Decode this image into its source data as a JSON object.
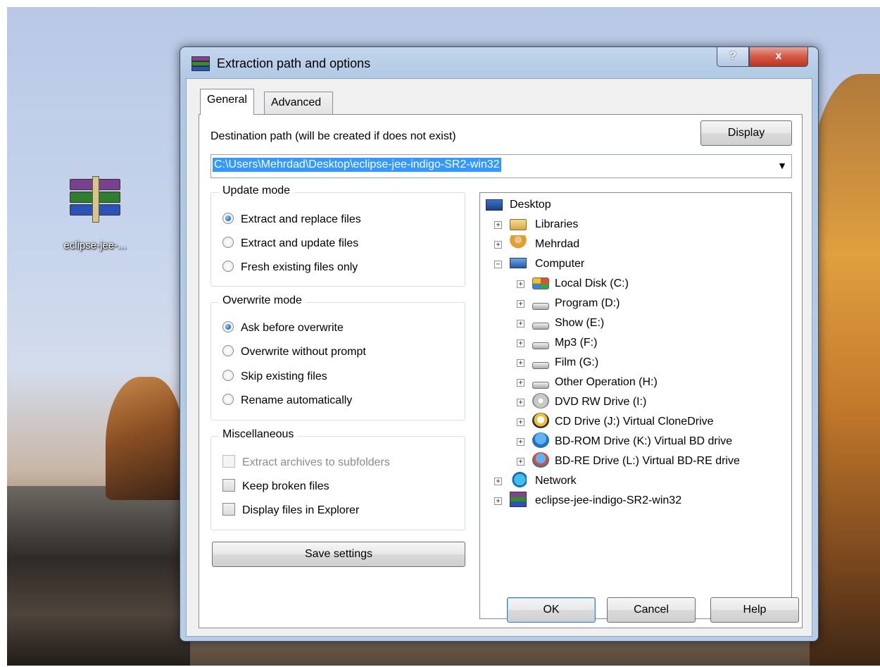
{
  "desktop": {
    "icon_label": "eclipse-jee-..."
  },
  "window": {
    "title": "Extraction path and options",
    "help_caption": "?",
    "close_caption": "x"
  },
  "tabs": [
    {
      "label": "General",
      "active": true
    },
    {
      "label": "Advanced",
      "active": false
    }
  ],
  "destination": {
    "label": "Destination path (will be created if does not exist)",
    "value": "C:\\Users\\Mehrdad\\Desktop\\eclipse-jee-indigo-SR2-win32",
    "display_button": "Display"
  },
  "update_mode": {
    "title": "Update mode",
    "options": [
      {
        "label": "Extract and replace files",
        "selected": true
      },
      {
        "label": "Extract and update files",
        "selected": false
      },
      {
        "label": "Fresh existing files only",
        "selected": false
      }
    ]
  },
  "overwrite_mode": {
    "title": "Overwrite mode",
    "options": [
      {
        "label": "Ask before overwrite",
        "selected": true
      },
      {
        "label": "Overwrite without prompt",
        "selected": false
      },
      {
        "label": "Skip existing files",
        "selected": false
      },
      {
        "label": "Rename automatically",
        "selected": false
      }
    ]
  },
  "miscellaneous": {
    "title": "Miscellaneous",
    "options": [
      {
        "label": "Extract archives to subfolders",
        "checked": false,
        "disabled": true
      },
      {
        "label": "Keep broken files",
        "checked": false,
        "disabled": false
      },
      {
        "label": "Display files in Explorer",
        "checked": false,
        "disabled": false
      }
    ]
  },
  "save_settings": "Save settings",
  "tree": [
    {
      "label": "Desktop",
      "icon": "desktop-icon"
    },
    {
      "label": "Libraries",
      "icon": "libraries-icon"
    },
    {
      "label": "Mehrdad",
      "icon": "user-folder-icon"
    },
    {
      "label": "Computer",
      "icon": "computer-icon"
    },
    {
      "label": "Local Disk (C:)",
      "icon": "windows-drive-icon"
    },
    {
      "label": "Program (D:)",
      "icon": "hard-drive-icon"
    },
    {
      "label": "Show (E:)",
      "icon": "hard-drive-icon"
    },
    {
      "label": "Mp3 (F:)",
      "icon": "hard-drive-icon"
    },
    {
      "label": "Film (G:)",
      "icon": "hard-drive-icon"
    },
    {
      "label": "Other Operation (H:)",
      "icon": "hard-drive-icon"
    },
    {
      "label": "DVD RW Drive (I:)",
      "icon": "dvd-drive-icon"
    },
    {
      "label": "CD Drive (J:) Virtual CloneDrive",
      "icon": "clonedrive-icon"
    },
    {
      "label": "BD-ROM Drive (K:) Virtual BD drive",
      "icon": "bd-rom-icon"
    },
    {
      "label": "BD-RE Drive (L:) Virtual BD-RE drive",
      "icon": "bd-re-icon"
    },
    {
      "label": "Network",
      "icon": "network-icon"
    },
    {
      "label": "eclipse-jee-indigo-SR2-win32",
      "icon": "winrar-archive-icon"
    }
  ],
  "buttons": {
    "ok": "OK",
    "cancel": "Cancel",
    "help": "Help"
  }
}
